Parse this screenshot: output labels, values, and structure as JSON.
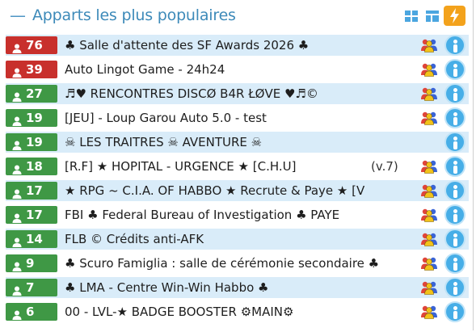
{
  "header": {
    "dash": "—",
    "title": "Apparts les plus populaires"
  },
  "colors": {
    "accent": "#3d8ab9",
    "badge_red": "#c8302c",
    "badge_green": "#3f9845",
    "row_alt": "#d9ecf9",
    "info": "#47aee7",
    "bolt": "#f3a21c"
  },
  "rooms": [
    {
      "count": "76",
      "name": "♣ Salle d'attente des SF Awards 2026 ♣",
      "badge": "red",
      "users_icon": true,
      "version": ""
    },
    {
      "count": "39",
      "name": "Auto Lingot Game - 24h24",
      "badge": "red",
      "users_icon": true,
      "version": ""
    },
    {
      "count": "27",
      "name": "♬♥ RENCONTRES DISCØ B4R ŁØVE ♥♬©",
      "badge": "green",
      "users_icon": true,
      "version": ""
    },
    {
      "count": "19",
      "name": "[JEU] - Loup Garou Auto 5.0 - test",
      "badge": "green",
      "users_icon": true,
      "version": ""
    },
    {
      "count": "19",
      "name": "☠ LES TRAITRES ☠ AVENTURE ☠",
      "badge": "green",
      "users_icon": false,
      "version": ""
    },
    {
      "count": "18",
      "name": "[R.F] ★ HOPITAL - URGENCE ★ [C.H.U]",
      "badge": "green",
      "users_icon": true,
      "version": "(v.7)"
    },
    {
      "count": "17",
      "name": "★ RPG ~ C.I.A. OF HABBO ★ Recrute & Paye ★ [V",
      "badge": "green",
      "users_icon": true,
      "version": ""
    },
    {
      "count": "17",
      "name": "FBI ♣ Federal Bureau of Investigation ♣ PAYE",
      "badge": "green",
      "users_icon": true,
      "version": ""
    },
    {
      "count": "14",
      "name": "FLB © Crédits anti-AFK",
      "badge": "green",
      "users_icon": true,
      "version": ""
    },
    {
      "count": "9",
      "name": "♣ Scuro Famiglia : salle de cérémonie secondaire ♣",
      "badge": "green",
      "users_icon": true,
      "version": ""
    },
    {
      "count": "7",
      "name": "♣ LMA - Centre Win-Win Habbo ♣",
      "badge": "green",
      "users_icon": true,
      "version": ""
    },
    {
      "count": "6",
      "name": "00 - LVL-★  BADGE BOOSTER  ⚙MAIN⚙",
      "badge": "green",
      "users_icon": true,
      "version": ""
    }
  ]
}
